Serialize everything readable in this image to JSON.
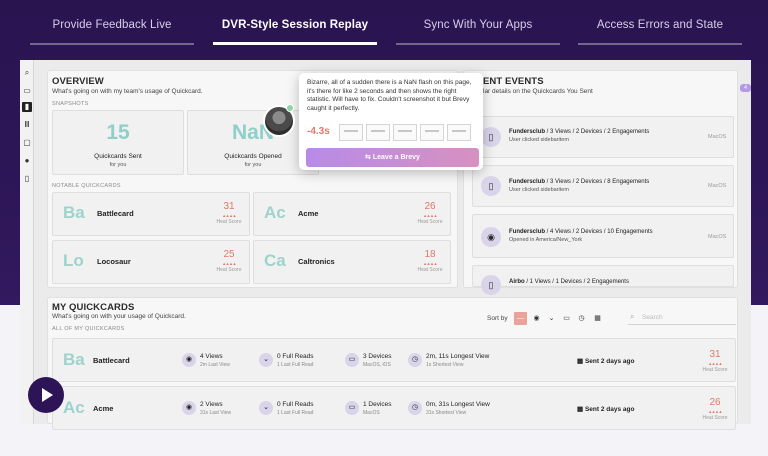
{
  "nav": {
    "items": [
      {
        "label": "Provide Feedback Live"
      },
      {
        "label": "DVR-Style Session Replay"
      },
      {
        "label": "Sync With Your Apps"
      },
      {
        "label": "Access Errors and State"
      }
    ],
    "active_index": 1
  },
  "overview": {
    "title": "OVERVIEW",
    "subtitle": "What's going on with my team's usage of Quickcard.",
    "snapshots_label": "SNAPSHOTS",
    "snapshots": [
      {
        "value": "15",
        "label": "Quickcards Sent",
        "sub": "for you"
      },
      {
        "value": "NaN",
        "label": "Quickcards Opened",
        "sub": "for you"
      }
    ],
    "notable_label": "NOTABLE QUICKCARDS",
    "notable": [
      {
        "abbr": "Ba",
        "name": "Battlecard",
        "score": "31",
        "score_label": "Heat Score"
      },
      {
        "abbr": "Ac",
        "name": "Acme",
        "score": "26",
        "score_label": "Heat Score"
      },
      {
        "abbr": "Lo",
        "name": "Locosaur",
        "score": "25",
        "score_label": "Heat Score"
      },
      {
        "abbr": "Ca",
        "name": "Caltronics",
        "score": "18",
        "score_label": "Heat Score"
      }
    ]
  },
  "events": {
    "title": "ENT EVENTS",
    "subtitle": "lar details on the Quickcards You Sent",
    "items": [
      {
        "icon": "mouse-icon",
        "company": "Fundersclub",
        "detail": " / 3 Views / 2 Devices / 2 Engagements",
        "sub": "User clicked sidebaritem",
        "os": "MacOS"
      },
      {
        "icon": "mouse-icon",
        "company": "Fundersclub",
        "detail": " / 3 Views / 2 Devices / 8 Engagements",
        "sub": "User clicked sidebaritem",
        "os": "MacOS"
      },
      {
        "icon": "eye-icon",
        "company": "Fundersclub",
        "detail": " / 4 Views / 2 Devices / 10 Engagements",
        "sub": "Opened in America/New_York",
        "os": "MacOS"
      },
      {
        "icon": "mouse-icon",
        "company": "Airbo",
        "detail": " / 1 Views / 1 Devices / 2 Engagements",
        "sub": "",
        "os": ""
      }
    ],
    "badge": "4"
  },
  "popup": {
    "text": "Bizarre, all of a sudden there is a NaN flash on this page, it's there for like 2 seconds and then shows the right statistic. Will have to fix. Couldn't screenshot it but Brevy caught it perfectly.",
    "delta": "-4.3s",
    "button_label": "Leave a Brevy"
  },
  "my_quickcards": {
    "title": "MY QUICKCARDS",
    "subtitle": "What's going on with your usage of Quickcard.",
    "all_label": "ALL OF MY QUICKCARDS",
    "sort_label": "Sort by",
    "search_placeholder": "Search",
    "rows": [
      {
        "abbr": "Ba",
        "name": "Battlecard",
        "views": "4 Views",
        "views_sub": "2m Last View",
        "reads": "0 Full Reads",
        "reads_sub": "1 Last Full Read",
        "devices": "3 Devices",
        "devices_sub": "MacOS, iOS",
        "longest": "2m, 11s Longest View",
        "longest_sub": "1s Shortest View",
        "sent": "Sent 2 days ago",
        "score": "31",
        "score_label": "Heat Score"
      },
      {
        "abbr": "Ac",
        "name": "Acme",
        "views": "2 Views",
        "views_sub": "31s Last View",
        "reads": "0 Full Reads",
        "reads_sub": "1 Last Full Read",
        "devices": "1 Devices",
        "devices_sub": "MacOS",
        "longest": "0m, 31s Longest View",
        "longest_sub": "31s Shortest View",
        "sent": "Sent 2 days ago",
        "score": "26",
        "score_label": "Heat Score"
      }
    ]
  },
  "colors": {
    "hero_bg": "#2a1450",
    "accent_teal": "#8fcfc8",
    "heat_red": "#e07868",
    "purple_btn": "#b78be8"
  }
}
